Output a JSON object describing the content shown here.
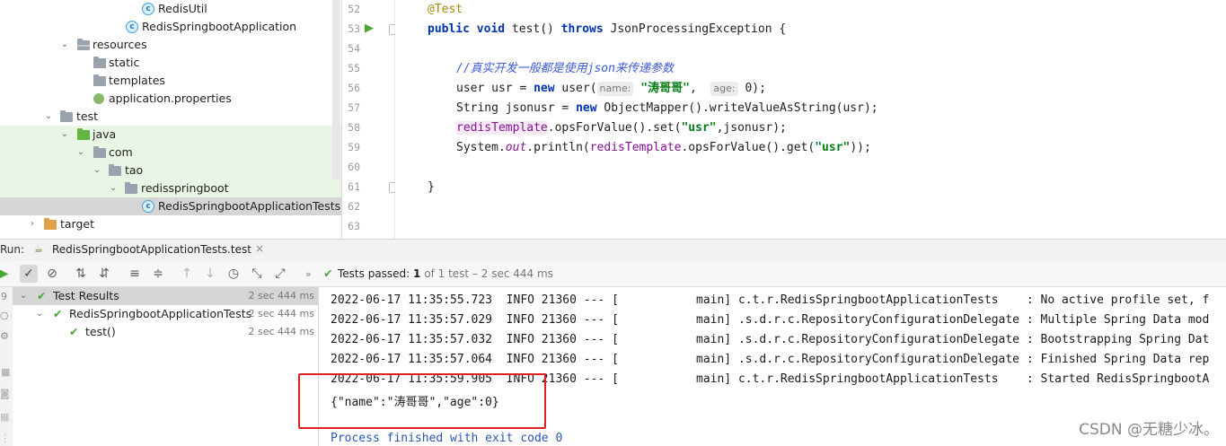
{
  "tree": {
    "items": [
      {
        "label": "RedisUtil"
      },
      {
        "label": "RedisSpringbootApplication"
      },
      {
        "label": "resources"
      },
      {
        "label": "static"
      },
      {
        "label": "templates"
      },
      {
        "label": "application.properties"
      },
      {
        "label": "test"
      },
      {
        "label": "java"
      },
      {
        "label": "com"
      },
      {
        "label": "tao"
      },
      {
        "label": "redisspringboot"
      },
      {
        "label": "RedisSpringbootApplicationTests"
      },
      {
        "label": "target"
      }
    ]
  },
  "editor": {
    "line_numbers": [
      "52",
      "53",
      "54",
      "55",
      "56",
      "57",
      "58",
      "59",
      "60",
      "61",
      "62",
      "63"
    ],
    "l52": "@Test",
    "l53_kw1": "public void ",
    "l53_name": "test() ",
    "l53_kw2": "throws ",
    "l53_rest": "JsonProcessingException {",
    "l55_comment": "//真实开发一般都是使用json来传递参数",
    "l56_a": "user usr = ",
    "l56_new": "new ",
    "l56_b": "user(",
    "l56_hint1": "name:",
    "l56_str": "\"涛哥哥\"",
    "l56_c": ",  ",
    "l56_hint2": "age:",
    "l56_d": " 0);",
    "l57_a": "String jsonusr = ",
    "l57_new": "new ",
    "l57_b": "ObjectMapper().writeValueAsString(usr);",
    "l58_field": "redisTemplate",
    "l58_a": ".opsForValue().set(",
    "l58_str": "\"usr\"",
    "l58_b": ",jsonusr);",
    "l59_a": "System.",
    "l59_out": "out",
    "l59_b": ".println(",
    "l59_field": "redisTemplate",
    "l59_c": ".opsForValue().get(",
    "l59_str": "\"usr\"",
    "l59_d": "));",
    "l61": "}"
  },
  "run": {
    "label": "Run:",
    "tab": "RedisSpringbootApplicationTests.test",
    "status_bold": "Tests passed:",
    "status_count": "1",
    "status_rest": "of 1 test – 2 sec 444 ms"
  },
  "results": [
    {
      "label": "Test Results",
      "duration": "2 sec 444 ms"
    },
    {
      "label": "RedisSpringbootApplicationTests",
      "duration": "2 sec 444 ms"
    },
    {
      "label": "test()",
      "duration": "2 sec 444 ms"
    }
  ],
  "console": {
    "lines": [
      "2022-06-17 11:35:55.723  INFO 21360 --- [           main] c.t.r.RedisSpringbootApplicationTests    : No active profile set, f",
      "2022-06-17 11:35:57.029  INFO 21360 --- [           main] .s.d.r.c.RepositoryConfigurationDelegate : Multiple Spring Data mod",
      "2022-06-17 11:35:57.032  INFO 21360 --- [           main] .s.d.r.c.RepositoryConfigurationDelegate : Bootstrapping Spring Dat",
      "2022-06-17 11:35:57.064  INFO 21360 --- [           main] .s.d.r.c.RepositoryConfigurationDelegate : Finished Spring Data rep",
      "2022-06-17 11:35:59.905  INFO 21360 --- [           main] c.t.r.RedisSpringbootApplicationTests    : Started RedisSpringbootA",
      "{\"name\":\"涛哥哥\",\"age\":0}",
      "Process finished with exit code 0"
    ]
  },
  "watermark": "CSDN @无糖少冰。",
  "colors": {
    "accent_green": "#4aa637",
    "highlight_red": "#e02020",
    "keyword": "#0033b3",
    "string": "#067d17"
  }
}
